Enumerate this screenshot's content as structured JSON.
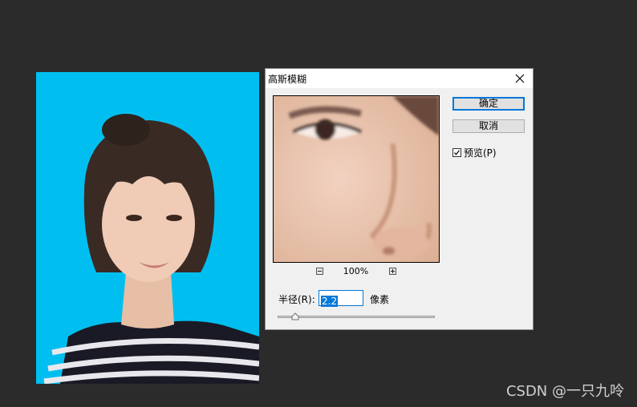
{
  "dialog": {
    "title": "高斯模糊",
    "ok_label": "确定",
    "cancel_label": "取消",
    "preview_label": "预览(P)",
    "preview_checked": true,
    "zoom_level": "100%",
    "radius_label": "半径(R):",
    "radius_value": "2.2",
    "unit_label": "像素"
  },
  "icons": {
    "close": "close-icon",
    "zoom_out": "zoom-out-icon",
    "zoom_in": "zoom-in-icon",
    "check": "check-icon"
  },
  "colors": {
    "canvas_background": "#2b2b2b",
    "photo_background": "#00bff0",
    "accent": "#0078d7"
  },
  "watermark": "CSDN @一只九呤"
}
